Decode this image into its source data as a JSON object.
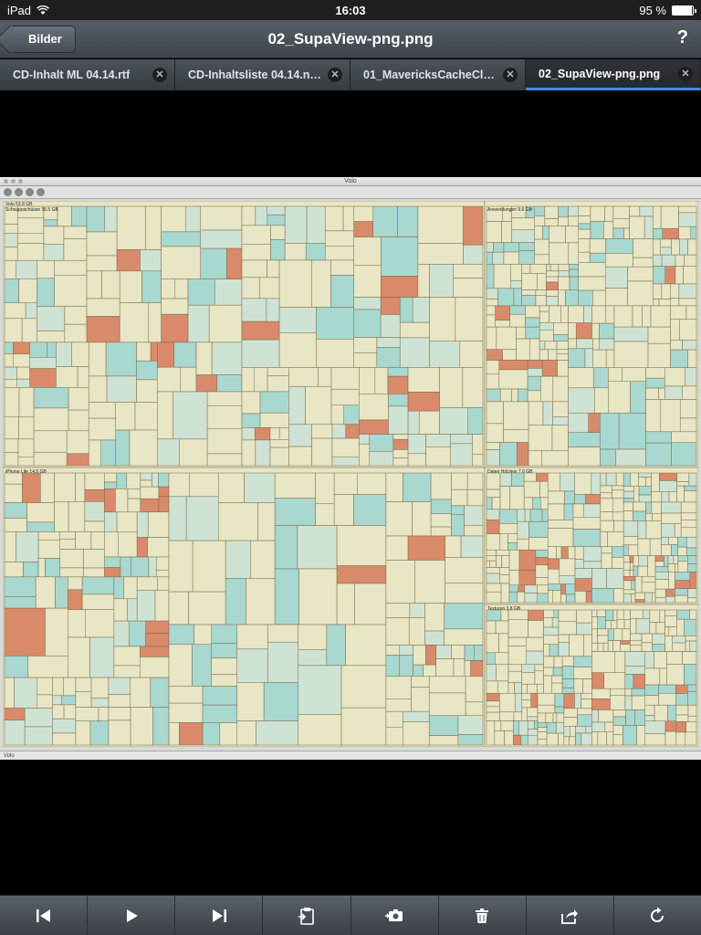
{
  "status": {
    "device": "iPad",
    "time": "16:03",
    "battery": "95 %",
    "battery_level": 0.95
  },
  "nav": {
    "back_label": "Bilder",
    "title": "02_SupaView-png.png",
    "help_label": "?"
  },
  "tabs": [
    {
      "label": "CD-Inhalt ML 04.14.rtf",
      "active": false
    },
    {
      "label": "CD-Inhaltsliste 04.14.nu...",
      "active": false
    },
    {
      "label": "01_MavericksCacheClea...",
      "active": false
    },
    {
      "label": "02_SupaView-png.png",
      "active": true
    }
  ],
  "image": {
    "window_title": "Volo",
    "status_text": "Volo",
    "regions": [
      {
        "label": "Volo",
        "size": "53.8 GB"
      },
      {
        "label": "Schnappschüsse",
        "size": "16.5 GB"
      },
      {
        "label": "iPhone Life",
        "size": "14.5 GB"
      },
      {
        "label": "Anwendungen",
        "size": "9.6 GB"
      },
      {
        "label": "Daten Hölzlein",
        "size": "7.6 GB"
      },
      {
        "label": "Texturen",
        "size": "3.8 GB"
      }
    ]
  },
  "toolbar": {
    "buttons": [
      {
        "name": "skip-back-button",
        "icon": "skip-back-icon"
      },
      {
        "name": "play-button",
        "icon": "play-icon"
      },
      {
        "name": "skip-forward-button",
        "icon": "skip-forward-icon"
      },
      {
        "name": "paste-button",
        "icon": "clipboard-icon"
      },
      {
        "name": "camera-button",
        "icon": "camera-icon"
      },
      {
        "name": "delete-button",
        "icon": "trash-icon"
      },
      {
        "name": "share-button",
        "icon": "share-icon"
      },
      {
        "name": "refresh-button",
        "icon": "refresh-icon"
      }
    ]
  },
  "colors": {
    "cell": "#e8e6c4",
    "cell_alt": "#cfe3d4",
    "cell_teal": "#a8d8d0",
    "cell_orange": "#d98a6a",
    "border": "#7a6a48"
  }
}
